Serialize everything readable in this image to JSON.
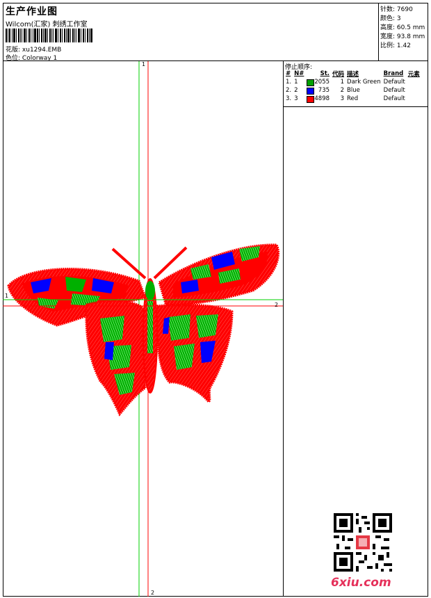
{
  "header": {
    "title": "生产作业图",
    "subtitle": "Wilcom(汇家) 刺绣工作室",
    "design_label": "花版:",
    "design_value": "xu1294.EMB",
    "colorway_label": "色位:",
    "colorway_value": "Colorway 1"
  },
  "stats": {
    "stitches": "针数: 7690",
    "colors": "颜色: 3",
    "height": "高度: 60.5 mm",
    "width": "宽度: 93.8 mm",
    "scale": "比例: 1.42"
  },
  "stop_sequence": {
    "title": "停止顺序:",
    "headers": [
      "#",
      "N#",
      "St.",
      "代码",
      "描述",
      "Brand",
      "元素"
    ],
    "rows": [
      {
        "idx": "1.",
        "n": "1",
        "swatch": "#00a000",
        "stitches": "2055",
        "code": "1",
        "desc": "Dark Green",
        "brand": "Default"
      },
      {
        "idx": "2.",
        "n": "2",
        "swatch": "#0000ff",
        "stitches": "735",
        "code": "2",
        "desc": "Blue",
        "brand": "Default"
      },
      {
        "idx": "3.",
        "n": "3",
        "swatch": "#ff0000",
        "stitches": "4898",
        "code": "3",
        "desc": "Red",
        "brand": "Default"
      }
    ]
  },
  "axes": {
    "v_top": "1",
    "v_bottom": "2",
    "h_left": "1",
    "h_right": "2"
  },
  "colors": {
    "green": "#00c000",
    "blue": "#0000ff",
    "red": "#ff0000"
  },
  "watermark": {
    "site": "6xiu.com"
  }
}
